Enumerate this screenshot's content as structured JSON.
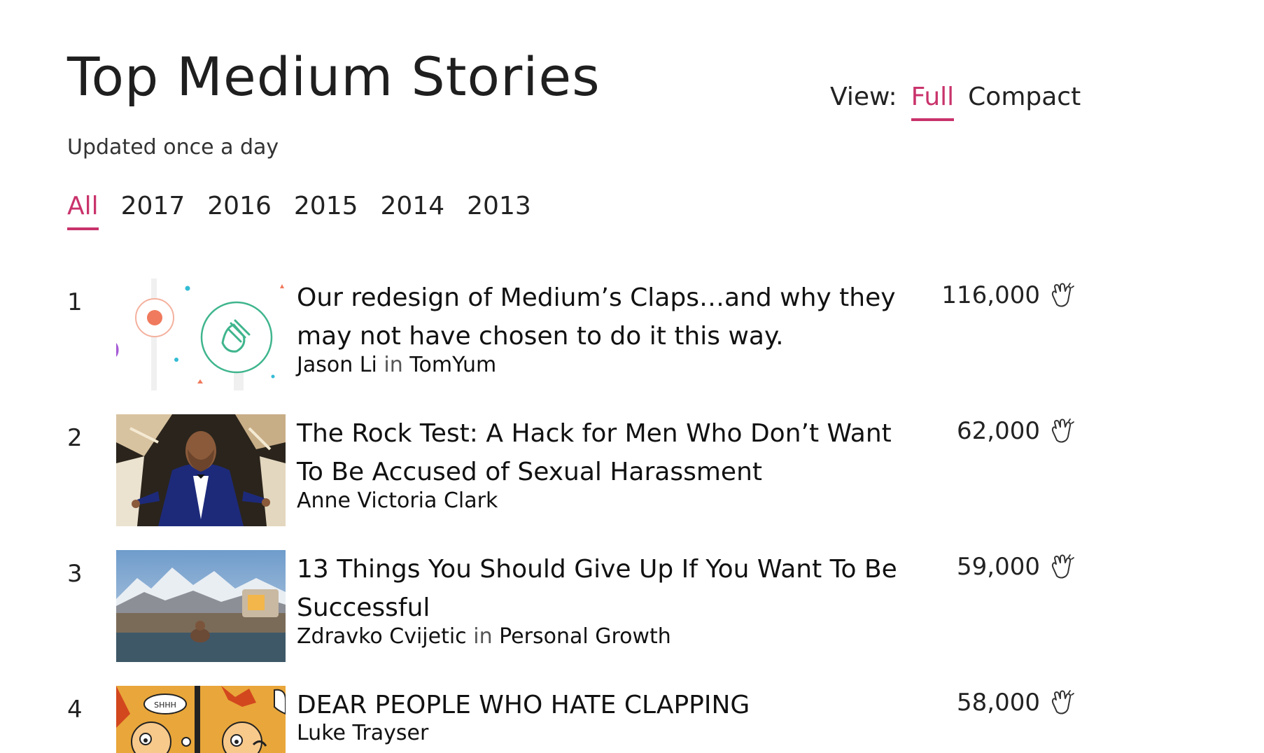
{
  "page": {
    "title": "Top Medium Stories",
    "subtitle": "Updated once a day"
  },
  "view_toggle": {
    "label": "View:",
    "options": [
      "Full",
      "Compact"
    ],
    "active": "Full",
    "accent_color": "#c9336b"
  },
  "year_filter": {
    "options": [
      "All",
      "2017",
      "2016",
      "2015",
      "2014",
      "2013"
    ],
    "active": "All"
  },
  "stories": [
    {
      "rank": "1",
      "title": "Our redesign of Medium’s Claps…and why they may not have chosen to do it this way.",
      "author": "Jason Li",
      "in_label": "in",
      "publication": "TomYum",
      "claps": "116,000",
      "icon": "clap-icon"
    },
    {
      "rank": "2",
      "title": "The Rock Test: A Hack for Men Who Don’t Want To Be Accused of Sexual Harassment",
      "author": "Anne Victoria Clark",
      "claps": "62,000",
      "icon": "clap-icon"
    },
    {
      "rank": "3",
      "title": "13 Things You Should Give Up If You Want To Be Successful",
      "author": "Zdravko Cvijetic",
      "in_label": "in",
      "publication": "Personal Growth",
      "claps": "59,000",
      "icon": "clap-icon"
    },
    {
      "rank": "4",
      "title": "DEAR PEOPLE WHO HATE CLAPPING",
      "author": "Luke Trayser",
      "claps": "58,000",
      "icon": "clap-icon"
    }
  ]
}
